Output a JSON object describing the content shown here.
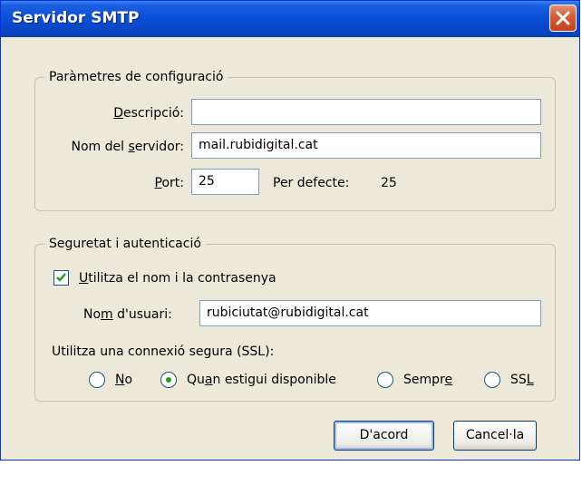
{
  "window": {
    "title": "Servidor SMTP",
    "close_icon": "close-icon"
  },
  "config_group": {
    "legend": "Paràmetres de configuració",
    "description": {
      "label_pre": "",
      "label_u": "D",
      "label_post": "escripció:",
      "value": ""
    },
    "server": {
      "label_pre": "Nom del ",
      "label_u": "s",
      "label_post": "ervidor:",
      "value": "mail.rubidigital.cat"
    },
    "port": {
      "label_pre": "",
      "label_u": "P",
      "label_post": "ort:",
      "value": "25"
    },
    "default_label": "Per defecte:",
    "default_value": "25"
  },
  "security_group": {
    "legend": "Seguretat i autenticació",
    "use_name_password": {
      "label_pre": "",
      "label_u": "U",
      "label_post": "tilitza el nom i la contrasenya",
      "checked": true
    },
    "username": {
      "label_pre": "No",
      "label_u": "m",
      "label_post": " d'usuari:",
      "value": "rubiciutat@rubidigital.cat"
    },
    "ssl_label": "Utilitza una connexió segura (SSL):",
    "options": [
      {
        "pre": "",
        "u": "N",
        "post": "o",
        "selected": false
      },
      {
        "pre": "Qu",
        "u": "a",
        "post": "n estigui disponible",
        "selected": true
      },
      {
        "pre": "Sempr",
        "u": "e",
        "post": "",
        "selected": false
      },
      {
        "pre": "SS",
        "u": "L",
        "post": "",
        "selected": false
      }
    ]
  },
  "buttons": {
    "ok": "D'acord",
    "cancel": "Cancel·la"
  },
  "colors": {
    "titlebar": "#0a50d8",
    "dialog_bg": "#ece9d8",
    "check": "#21a121",
    "close": "#d85a32"
  }
}
